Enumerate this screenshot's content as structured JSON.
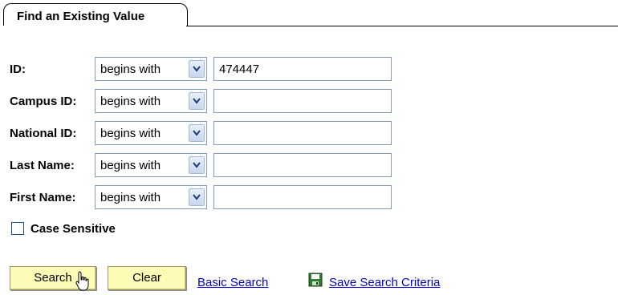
{
  "tab": {
    "title": "Find an Existing Value"
  },
  "rows": [
    {
      "label": "ID:",
      "operator": "begins with",
      "value": "474447"
    },
    {
      "label": "Campus ID:",
      "operator": "begins with",
      "value": ""
    },
    {
      "label": "National ID:",
      "operator": "begins with",
      "value": ""
    },
    {
      "label": "Last Name:",
      "operator": "begins with",
      "value": ""
    },
    {
      "label": "First Name:",
      "operator": "begins with",
      "value": ""
    }
  ],
  "case_sensitive": {
    "label": "Case Sensitive",
    "checked": false
  },
  "buttons": {
    "search": "Search",
    "clear": "Clear"
  },
  "links": {
    "basic_search": "Basic Search",
    "save_search": "Save Search Criteria"
  },
  "icons": {
    "dropdown": "chevron-down-icon",
    "save": "save-icon",
    "cursor": "hand-pointer-icon"
  }
}
